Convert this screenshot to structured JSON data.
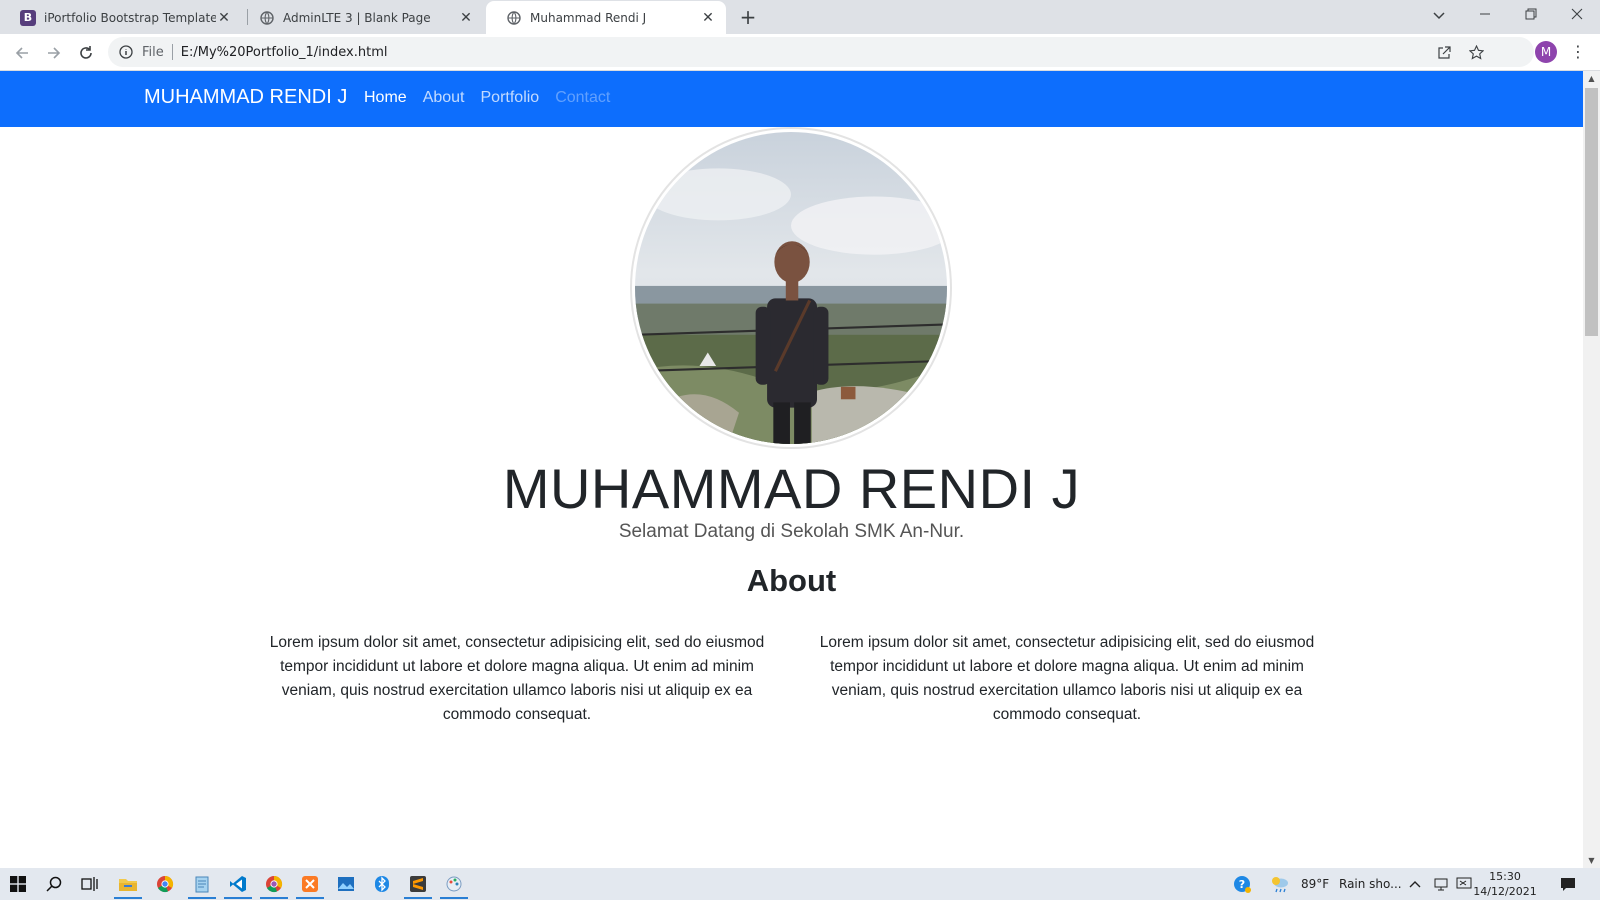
{
  "browser": {
    "tabs": [
      {
        "title": "iPortfolio Bootstrap Template - In",
        "favicon": "bootstrap-icon",
        "active": false
      },
      {
        "title": "AdminLTE 3 | Blank Page",
        "favicon": "globe-icon",
        "active": false
      },
      {
        "title": "Muhammad Rendi J",
        "favicon": "globe-icon",
        "active": true
      }
    ],
    "address": {
      "scheme": "File",
      "url": "E:/My%20Portfolio_1/index.html"
    },
    "profile_initial": "M"
  },
  "site": {
    "brand": "MUHAMMAD RENDI J",
    "nav": [
      {
        "label": "Home",
        "state": "active"
      },
      {
        "label": "About",
        "state": "normal"
      },
      {
        "label": "Portfolio",
        "state": "normal"
      },
      {
        "label": "Contact",
        "state": "disabled"
      }
    ],
    "nav_color": "#0d6efd",
    "hero": {
      "name": "MUHAMMAD RENDI J",
      "subtitle": "Selamat Datang di Sekolah SMK An-Nur."
    },
    "about": {
      "title": "About",
      "columns": [
        "Lorem ipsum dolor sit amet, consectetur adipisicing elit, sed do eiusmod tempor incididunt ut labore et dolore magna aliqua. Ut enim ad minim veniam, quis nostrud exercitation ullamco laboris nisi ut aliquip ex ea commodo consequat.",
        "Lorem ipsum dolor sit amet, consectetur adipisicing elit, sed do eiusmod tempor incididunt ut labore et dolore magna aliqua. Ut enim ad minim veniam, quis nostrud exercitation ullamco laboris nisi ut aliquip ex ea commodo consequat."
      ]
    }
  },
  "taskbar": {
    "weather": {
      "temp": "89°F",
      "condition": "Rain sho..."
    },
    "clock": {
      "time": "15:30",
      "date": "14/12/2021"
    }
  }
}
